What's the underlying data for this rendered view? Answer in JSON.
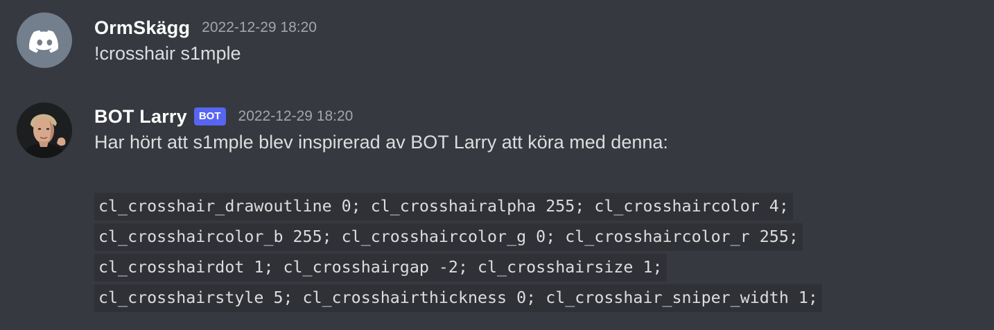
{
  "messages": [
    {
      "username": "OrmSkägg",
      "timestamp": "2022-12-29 18:20",
      "avatar_icon": "discord-logo-icon",
      "avatar_color": "#747f8d",
      "content": "!crosshair s1mple"
    },
    {
      "username": "BOT Larry",
      "bot_tag": "BOT",
      "bot_tag_color": "#5865f2",
      "timestamp": "2022-12-29 18:20",
      "avatar_icon": "user-photo-avatar",
      "content": "Har hört att s1mple blev inspirerad av BOT Larry att köra med denna:",
      "code_lines": [
        "cl_crosshair_drawoutline 0; cl_crosshairalpha 255; cl_crosshaircolor 4;",
        "cl_crosshaircolor_b 255; cl_crosshaircolor_g 0; cl_crosshaircolor_r 255;",
        "cl_crosshairdot 1; cl_crosshairgap -2; cl_crosshairsize 1;",
        "cl_crosshairstyle 5; cl_crosshairthickness 0; cl_crosshair_sniper_width 1;"
      ]
    }
  ]
}
